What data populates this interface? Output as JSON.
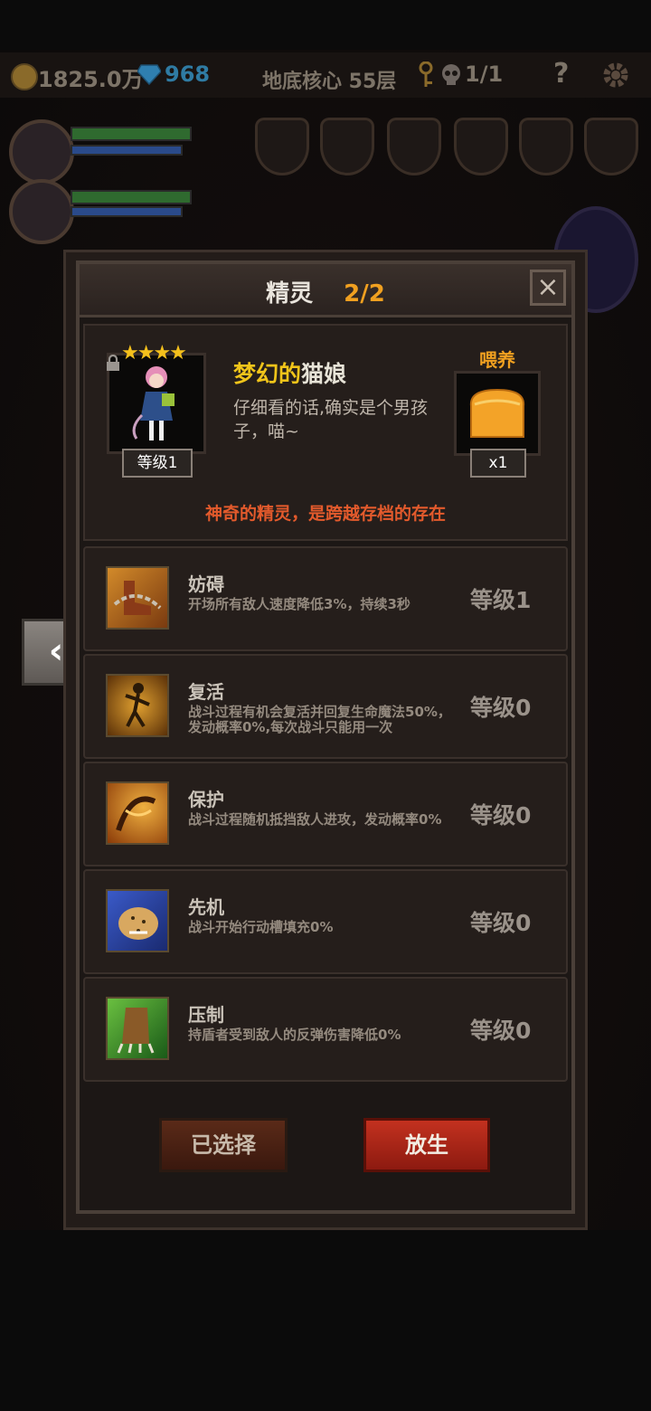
{
  "topbar": {
    "gold": "1825.0万",
    "gems": "968",
    "floor": "地底核心 55层",
    "keys": "1/1",
    "help": "?"
  },
  "dialog": {
    "title": "精灵",
    "count": "2/2",
    "close": "×"
  },
  "spirit": {
    "stars": "★★★★",
    "level": "等级1",
    "name_adj": "梦幻的",
    "name_noun": "猫娘",
    "description": "仔细看的话,确实是个男孩子，喵~",
    "feed_label": "喂养",
    "feed_count": "x1",
    "subtitle": "神奇的精灵，是跨越存档的存在"
  },
  "skills": [
    {
      "name": "妨碍",
      "desc": "开场所有敌人速度降低3%，持续3秒",
      "level": "等级1",
      "icon": "chain-boot-icon"
    },
    {
      "name": "复活",
      "desc": "战斗过程有机会复活并回复生命魔法50%，发动概率0%,每次战斗只能用一次",
      "level": "等级0",
      "icon": "revive-figure-icon"
    },
    {
      "name": "保护",
      "desc": "战斗过程随机抵挡敌人进攻，发动概率0%",
      "level": "等级0",
      "icon": "shield-figure-icon"
    },
    {
      "name": "先机",
      "desc": "战斗开始行动槽填充0%",
      "level": "等级0",
      "icon": "leopard-icon"
    },
    {
      "name": "压制",
      "desc": "持盾者受到敌人的反弹伤害降低0%",
      "level": "等级0",
      "icon": "beast-claw-icon"
    }
  ],
  "buttons": {
    "selected": "已选择",
    "release": "放生",
    "back": "‹"
  },
  "colors": {
    "accent_orange": "#f0a020",
    "name_yellow": "#f0c41a",
    "subtitle_red": "#e35a2c",
    "release_red": "#c3311f"
  }
}
